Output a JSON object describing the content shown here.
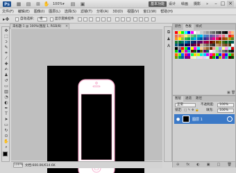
{
  "titlebar": {
    "logo": "Ps",
    "zoom": "100%",
    "workspaces": [
      "基本功能",
      "设计",
      "绘画",
      "摄影"
    ],
    "more": "»",
    "window_buttons": [
      "–",
      "□",
      "×"
    ]
  },
  "menu": [
    "文件(F)",
    "编辑(E)",
    "图像(I)",
    "图层(L)",
    "选择(S)",
    "滤镜(T)",
    "分析(A)",
    "3D(D)",
    "视图(V)",
    "窗口(W)",
    "帮助(H)"
  ],
  "options": {
    "auto_select": "自动选择：",
    "select_value": "组",
    "show_transform": "显示变换控件"
  },
  "document": {
    "tab_title": "未标题-1 @ 100%(图层 1, RGB/8)",
    "close": "×"
  },
  "status": {
    "zoom": "100%",
    "doc_size": "文档:600.0K/614.6K"
  },
  "swatch_panel": {
    "tabs": [
      "颜色",
      "色板",
      "样式"
    ],
    "colors": [
      "#ff0000",
      "#ffff00",
      "#00ff00",
      "#00ffff",
      "#0000ff",
      "#ff00ff",
      "#ffffff",
      "#e6e6e6",
      "#cccccc",
      "#b3b3b3",
      "#999999",
      "#808080",
      "#666666",
      "#4d4d4d",
      "#333333",
      "#1a1a1a",
      "#000000",
      "#ff7f7f",
      "#ffbf7f",
      "#f26c4f",
      "#f68e55",
      "#fbaf5c",
      "#fff467",
      "#acd372",
      "#7cc576",
      "#3bb878",
      "#1abbb4",
      "#00bff3",
      "#438ccb",
      "#5574b9",
      "#605ca8",
      "#855fa8",
      "#a763a8",
      "#f06ea9",
      "#f26d7d",
      "#c6c6c6",
      "#ed1c24",
      "#f26522",
      "#f7941d",
      "#fff200",
      "#8dc63f",
      "#39b54a",
      "#00a651",
      "#00a99d",
      "#00aeef",
      "#0072bc",
      "#0054a6",
      "#2e3192",
      "#662d91",
      "#92278f",
      "#ec008c",
      "#ed145b",
      "#9e0b0f",
      "#a0410d",
      "#a36209",
      "#aba000",
      "#598527",
      "#1a7b30",
      "#007236",
      "#00746b",
      "#0076a3",
      "#004a80",
      "#003471",
      "#1b1464",
      "#440e62",
      "#630460",
      "#9e005d",
      "#9e0039",
      "#790000",
      "#7b2e00",
      "#7d4900",
      "#827b00",
      "#406618",
      "#005e20",
      "#005826",
      "#005952",
      "#005b7f",
      "#003663",
      "#002157",
      "#0d004c",
      "#32004b",
      "#4b0049",
      "#7b0046",
      "#7a0026",
      "#c7b299",
      "#998675",
      "#736357",
      "#534741",
      "#37302d",
      "#c69c6d",
      "#a67c52",
      "#8c6239",
      "#754c24",
      "#603913",
      "#ffffff",
      "#000000",
      "#808080",
      "#ff0000",
      "#00ff00",
      "#0000ff",
      "#ffff00",
      "#ff00ff",
      "#00ffff",
      "#ffcc99",
      "#cc9966",
      "#996633",
      "#663300",
      "#ff9999",
      "#99ff99",
      "#9999ff",
      "#ffff99",
      "#ff99ff",
      "#99ffff",
      "#cc0000",
      "#00cc00",
      "#0000cc",
      "#cccc00",
      "#cc00cc",
      "#00cccc",
      "#660000",
      "#006600",
      "#000066",
      "#666600",
      "#660066",
      "#006666",
      "#f5f5f5",
      "#dddddd",
      "#bbbbbb",
      "#999999",
      "#777777",
      "#555555",
      "#333333",
      "#111111",
      "#ff6600",
      "#66ff00",
      "#0066ff",
      "#ff0066",
      "#6600ff",
      "#00ff66",
      "#ffcc00",
      "#ccff00",
      "#00ffcc",
      "#00ccff",
      "#cc00ff",
      "#ff00cc",
      "#ff3300",
      "#33ff00",
      "#0033ff",
      "#ff0033",
      "#3300ff",
      "#00ff33",
      "#996600",
      "#669900",
      "#009966",
      "#006699",
      "#660099",
      "#990066",
      "#ffe6cc",
      "#e6ffcc",
      "#cce6ff",
      "#ffcce6",
      "#e6ccff",
      "#ccffe6",
      "#b30000",
      "#00b300",
      "#0000b3",
      "#b3b300",
      "#b300b3",
      "#00b3b3",
      "#4d0000",
      "#004d00"
    ]
  },
  "layers_panel": {
    "tabs": [
      "图层",
      "通道",
      "路径"
    ],
    "blend_mode": "正常",
    "opacity_label": "不透明度:",
    "opacity": "100%",
    "lock_label": "锁定:",
    "fill_label": "填充:",
    "fill": "100%",
    "layer_name": "图层 1",
    "bottom_icons": [
      "⊖",
      "fx",
      "◐",
      "▣",
      "□",
      "🗑"
    ]
  },
  "phone_colors": {
    "outline": "#f3a0c4",
    "screen": "#000000",
    "body": "#ffffff"
  }
}
